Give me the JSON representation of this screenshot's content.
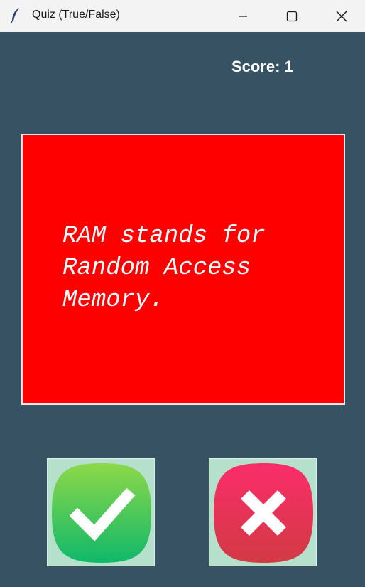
{
  "window": {
    "title": "Quiz (True/False)"
  },
  "score": {
    "text": "Score: 1"
  },
  "question": {
    "text": "RAM stands for\nRandom Access\nMemory."
  },
  "colors": {
    "background": "#375263",
    "card": "#ff0000",
    "button_bg": "#b4e0cc"
  },
  "buttons": {
    "true_icon": "check-icon",
    "false_icon": "cross-icon"
  }
}
